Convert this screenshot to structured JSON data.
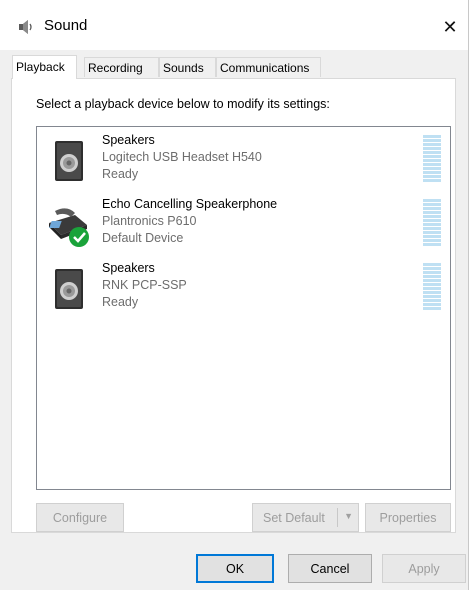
{
  "window": {
    "title": "Sound",
    "close_glyph": "✕"
  },
  "tabs": [
    {
      "label": "Playback",
      "active": true
    },
    {
      "label": "Recording",
      "active": false
    },
    {
      "label": "Sounds",
      "active": false
    },
    {
      "label": "Communications",
      "active": false
    }
  ],
  "playback": {
    "instructions": "Select a playback device below to modify its settings:",
    "devices": [
      {
        "name": "Speakers",
        "description": "Logitech USB Headset H540",
        "status": "Ready",
        "icon": "speaker-icon",
        "default": false
      },
      {
        "name": "Echo Cancelling Speakerphone",
        "description": "Plantronics P610",
        "status": "Default Device",
        "icon": "speakerphone-icon",
        "default": true
      },
      {
        "name": "Speakers",
        "description": "RNK PCP-SSP",
        "status": "Ready",
        "icon": "speaker-icon",
        "default": false
      }
    ],
    "buttons": {
      "configure": "Configure",
      "set_default": "Set Default",
      "properties": "Properties"
    }
  },
  "footer": {
    "ok": "OK",
    "cancel": "Cancel",
    "apply": "Apply"
  },
  "colors": {
    "default_check": "#1aa33a",
    "meter": "#bfe0f3",
    "accent": "#0078d7"
  }
}
